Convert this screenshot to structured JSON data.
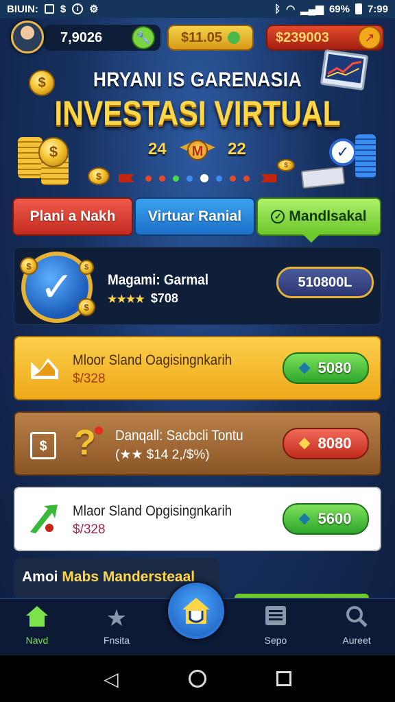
{
  "status_bar": {
    "left_text": "BIUIN:",
    "left_icons": [
      "image-icon",
      "dollar-icon",
      "info-icon",
      "gear-icon"
    ],
    "battery": "69%",
    "time": "7:99"
  },
  "top_bar": {
    "balance": "7,9026",
    "coins": "$11.05",
    "money": "$239003"
  },
  "banner": {
    "subtitle": "HRYANI IS GARENASIA",
    "title": "INVESTASI VIRTUAL",
    "left_num": "24",
    "right_num": "22",
    "badge_letter": "M"
  },
  "tabs": [
    {
      "label": "Plani a Nakh"
    },
    {
      "label": "Virtuar Ranial"
    },
    {
      "label": "Mandlsakal"
    }
  ],
  "cards": [
    {
      "title": "Magami: Garmal",
      "stars": "★★★★",
      "sub": "$708",
      "button": "510800L"
    },
    {
      "title": "Mloor Sland Oagisingnkarih",
      "sub": "$/328",
      "button": "5080"
    },
    {
      "title": "Danqall: Sacbcli Tontu",
      "sub": "(★★ $14 2,/$%)",
      "button": "8080"
    },
    {
      "title": "Mlaor Sland Opgisingnkarih",
      "sub": "$/328",
      "button": "5600"
    },
    {
      "title_a": "Amoi",
      "title_b": "Mabs Mandersteaal"
    }
  ],
  "nav": [
    {
      "label": "Navd"
    },
    {
      "label": "Fnsita"
    },
    {
      "label": "Sepo"
    },
    {
      "label": "Aureet"
    }
  ],
  "colors": {
    "accent_gold": "#ffd64a",
    "green": "#6cc82c",
    "red": "#c32b20",
    "blue": "#1d6fc8"
  }
}
